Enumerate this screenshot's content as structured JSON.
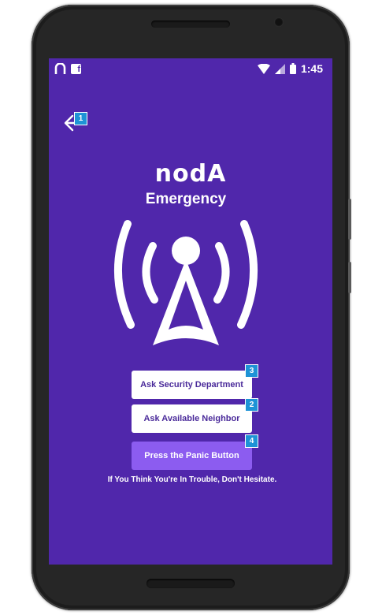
{
  "status_bar": {
    "time": "1:45",
    "left_icons": [
      "noda-notification-icon",
      "facebook-icon"
    ],
    "right_icons": [
      "wifi-icon",
      "signal-icon",
      "battery-icon"
    ]
  },
  "header": {
    "back_icon": "back-arrow-icon",
    "back_badge": "1"
  },
  "brand": {
    "logo_text": "nodA",
    "subtitle": "Emergency"
  },
  "illustration": "radio-tower-icon",
  "actions": [
    {
      "label": "Ask Security Department",
      "badge": "3"
    },
    {
      "label": "Ask Available Neighbor",
      "badge": "2"
    },
    {
      "label": "Press the Panic Button",
      "badge": "4"
    }
  ],
  "footer_note": "If You Think You're In Trouble, Don't Hesitate.",
  "colors": {
    "background": "#5027ab",
    "panic_button": "#8c5cf0",
    "badge": "#1e93d6"
  }
}
